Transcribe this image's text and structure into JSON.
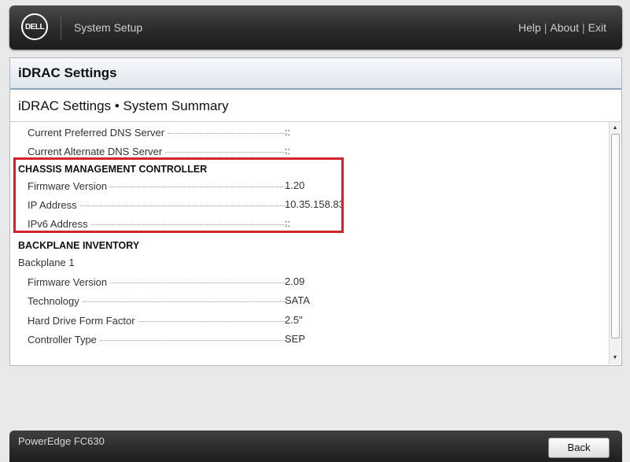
{
  "header": {
    "logo_text": "DELL",
    "app_title": "System Setup",
    "links": {
      "help": "Help",
      "about": "About",
      "exit": "Exit"
    },
    "separator": "|"
  },
  "panel": {
    "title": "iDRAC Settings",
    "breadcrumb": "iDRAC Settings • System Summary"
  },
  "dns": {
    "preferred": {
      "label": "Current Preferred DNS Server",
      "value": "::"
    },
    "alternate": {
      "label": "Current Alternate DNS Server",
      "value": "::"
    }
  },
  "cmc": {
    "heading": "CHASSIS MANAGEMENT CONTROLLER",
    "firmware": {
      "label": "Firmware Version",
      "value": "1.20"
    },
    "ip": {
      "label": "IP Address",
      "value": "10.35.158.83"
    },
    "ipv6": {
      "label": "IPv6 Address",
      "value": "::"
    }
  },
  "backplane": {
    "heading": "BACKPLANE INVENTORY",
    "name": "Backplane 1",
    "firmware": {
      "label": "Firmware Version",
      "value": "2.09"
    },
    "technology": {
      "label": "Technology",
      "value": "SATA"
    },
    "form_factor": {
      "label": "Hard Drive Form Factor",
      "value": "2.5\""
    },
    "controller": {
      "label": "Controller Type",
      "value": "SEP"
    }
  },
  "footer": {
    "model": "PowerEdge FC630",
    "back_label": "Back"
  },
  "colors": {
    "highlight": "#d2232a",
    "header_bg": "#2b2b2b",
    "section_header_border": "#8fa5bd"
  }
}
